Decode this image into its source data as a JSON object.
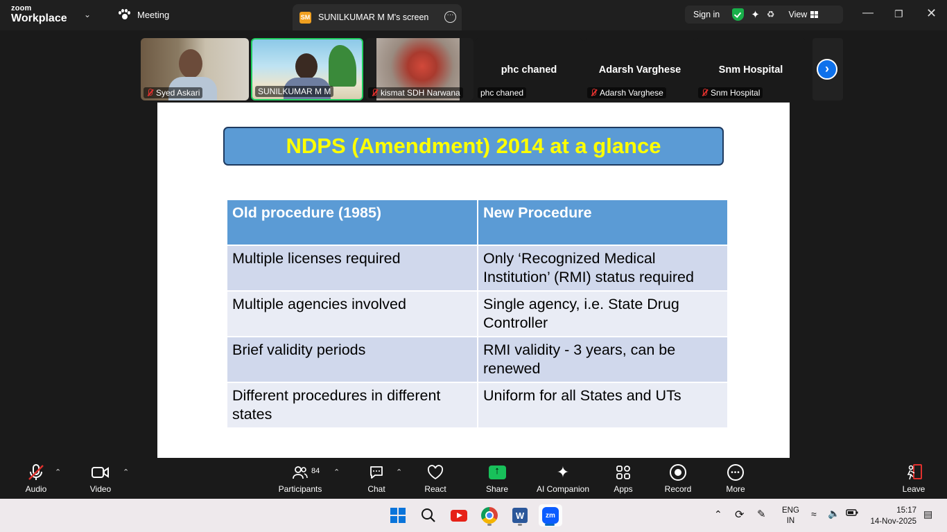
{
  "app": {
    "brand_small": "zoom",
    "brand_big": "Workplace",
    "meeting_label": "Meeting",
    "screen_tab_badge": "SM",
    "screen_tab_title": "SUNILKUMAR M M's screen",
    "sign_in": "Sign in",
    "view": "View"
  },
  "participants": [
    {
      "name": "Syed Askari",
      "muted": true
    },
    {
      "name": "SUNILKUMAR M M",
      "muted": false
    },
    {
      "name": "kismat SDH Narwana",
      "muted": true
    },
    {
      "name": "phc chaned",
      "muted": false,
      "big": "phc chaned"
    },
    {
      "name": "Adarsh Varghese",
      "muted": true,
      "big": "Adarsh Varghese"
    },
    {
      "name": "Snm Hospital",
      "muted": true,
      "big": "Snm Hospital"
    }
  ],
  "slide": {
    "title": "NDPS (Amendment) 2014 at a glance",
    "headers": [
      "Old procedure (1985)",
      "New Procedure"
    ],
    "rows": [
      [
        "Multiple licenses required",
        "Only ‘Recognized Medical Institution’ (RMI) status  required"
      ],
      [
        "Multiple agencies involved",
        "Single agency, i.e. State Drug Controller"
      ],
      [
        "Brief validity periods",
        "RMI validity - 3 years, can be renewed"
      ],
      [
        "Different procedures in  different states",
        "Uniform for all States and UTs"
      ]
    ]
  },
  "toolbar": {
    "audio": "Audio",
    "video": "Video",
    "participants": "Participants",
    "participants_count": "84",
    "chat": "Chat",
    "react": "React",
    "share": "Share",
    "ai_companion": "AI Companion",
    "apps": "Apps",
    "record": "Record",
    "more": "More",
    "leave": "Leave"
  },
  "taskbar": {
    "lang_top": "ENG",
    "lang_bottom": "IN",
    "time": "15:17",
    "date": "14-Nov-2025"
  }
}
